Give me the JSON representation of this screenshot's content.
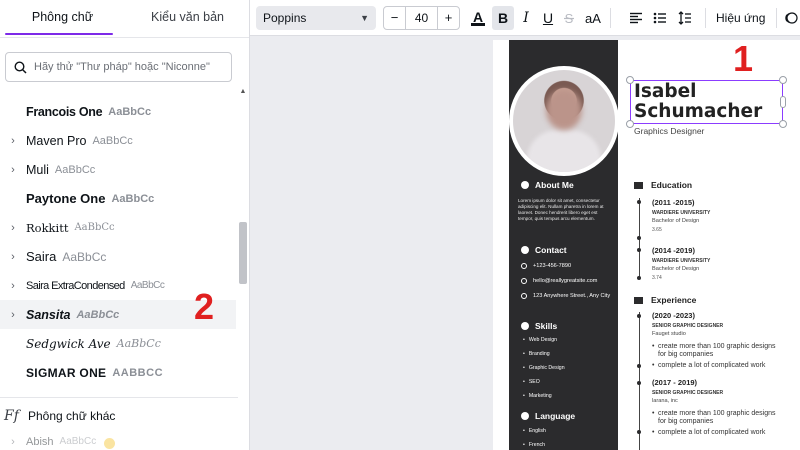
{
  "left_panel": {
    "tabs": [
      "Phông chữ",
      "Kiểu văn bản"
    ],
    "search_placeholder": "Hãy thử \"Thư pháp\" hoặc \"Niconne\"",
    "fonts": [
      {
        "name": "Francois One",
        "sample": "AaBbCc",
        "has_chevron": false
      },
      {
        "name": "Maven Pro",
        "sample": "AaBbCc",
        "has_chevron": true
      },
      {
        "name": "Muli",
        "sample": "AaBbCc",
        "has_chevron": true
      },
      {
        "name": "Paytone One",
        "sample": "AaBbCc",
        "has_chevron": false
      },
      {
        "name": "Rokkitt",
        "sample": "AaBbCc",
        "has_chevron": true
      },
      {
        "name": "Saira",
        "sample": "AaBbCc",
        "has_chevron": true
      },
      {
        "name": "Saira ExtraCondensed",
        "sample": "AaBbCc",
        "has_chevron": true
      },
      {
        "name": "Sansita",
        "sample": "AaBbCc",
        "has_chevron": true
      },
      {
        "name": "Sedgwick Ave",
        "sample": "AaBbCc",
        "has_chevron": false
      },
      {
        "name": "Sigmar One",
        "sample": "AaBbCc",
        "has_chevron": false
      }
    ],
    "more_fonts_icon": "Ff",
    "more_fonts_label": "Phông chữ khác",
    "cut_off_font": {
      "name": "Abish",
      "sample": "AaBbCc"
    }
  },
  "annotations": {
    "one": "1",
    "two": "2"
  },
  "toolbar": {
    "font_name": "Poppins",
    "font_size": "40",
    "minus": "−",
    "plus": "+",
    "text_color_glyph": "A",
    "bold": "B",
    "italic": "I",
    "underline": "U",
    "uppercase": "aA",
    "effects_label": "Hiệu ứng",
    "icons": [
      "text-color-icon",
      "bold-icon",
      "italic-icon",
      "underline-icon",
      "strikethrough-icon",
      "case-icon",
      "align-icon",
      "list-icon",
      "spacing-icon",
      "animate-icon"
    ],
    "accent_color": "#7d2ae8"
  },
  "resume": {
    "name": "Isabel Schumacher",
    "title": "Graphics Designer",
    "about_heading": "About Me",
    "about_text": "Lorem ipsum dolor sit amet, consectetur adipiscing elit. Nullam pharetra in lorem at laoreet. Donec hendrerit libero eget est tempor, quis tempus arcu elementum.",
    "contact_heading": "Contact",
    "contact": [
      "+123-456-7890",
      "hello@reallygreatsite.com",
      "123 Anywhere Street., Any City"
    ],
    "skills_heading": "Skills",
    "skills": [
      "Web Design",
      "Branding",
      "Graphic Design",
      "SEO",
      "Marketing"
    ],
    "language_heading": "Language",
    "languages": [
      "English",
      "French"
    ],
    "education_heading": "Education",
    "education": [
      {
        "years": "(2011 -2015)",
        "school": "WARDIERE UNIVERSITY",
        "degree": "Bachelor of Design",
        "gpa": "3.65"
      },
      {
        "years": "(2014 -2019)",
        "school": "WARDIERE UNIVERSITY",
        "degree": "Bachelor of Design",
        "gpa": "3.74"
      }
    ],
    "experience_heading": "Experience",
    "experience": [
      {
        "years": "(2020 -2023)",
        "role": "SENIOR GRAPHIC DESIGNER",
        "company": "Fauget studio",
        "bullets": [
          "create more than 100 graphic designs for big companies",
          "complete a lot of complicated work"
        ]
      },
      {
        "years": "(2017 - 2019)",
        "role": "SENIOR GRAPHIC DESIGNER",
        "company": "larana, inc",
        "bullets": [
          "create more than 100 graphic designs for big companies",
          "complete a lot of complicated work"
        ]
      }
    ],
    "colors": {
      "sidebar": "#2b2b2d",
      "selection": "#8b3dff"
    }
  }
}
